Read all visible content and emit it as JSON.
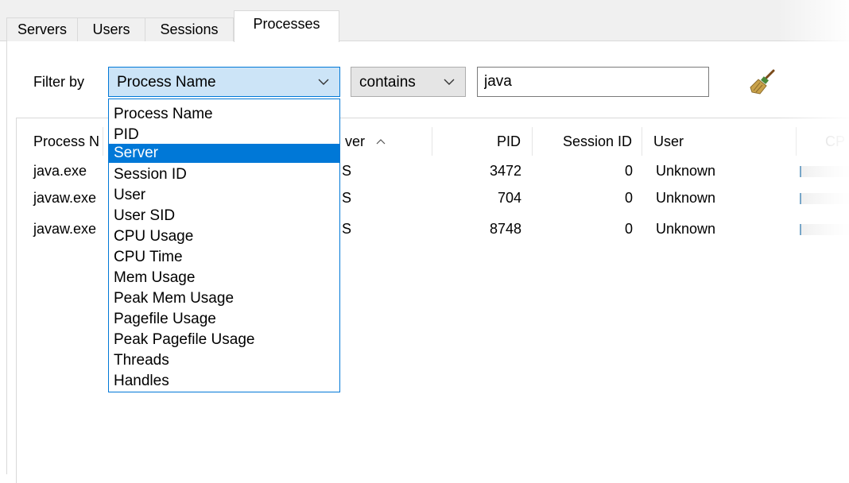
{
  "tabs": [
    {
      "label": "Servers"
    },
    {
      "label": "Users"
    },
    {
      "label": "Sessions"
    },
    {
      "label": "Processes",
      "active": true
    }
  ],
  "filter": {
    "label": "Filter by",
    "field_value": "Process Name",
    "operator_value": "contains",
    "text_value": "java"
  },
  "dropdown": {
    "options": [
      "Process Name",
      "PID",
      "Server",
      "Session ID",
      "User",
      "User SID",
      "CPU Usage",
      "CPU Time",
      "Mem Usage",
      "Peak Mem Usage",
      "Pagefile Usage",
      "Peak Pagefile Usage",
      "Threads",
      "Handles"
    ],
    "highlighted": "Server"
  },
  "columns": {
    "process_name": "Process N",
    "server": "ver",
    "pid": "PID",
    "session_id": "Session ID",
    "user": "User",
    "cpu": "CP"
  },
  "rows": [
    {
      "process_name": "java.exe",
      "server": "S",
      "pid": "3472",
      "session_id": "0",
      "user": "Unknown"
    },
    {
      "process_name": "javaw.exe",
      "server": "S",
      "pid": "704",
      "session_id": "0",
      "user": "Unknown"
    },
    {
      "process_name": "javaw.exe",
      "server": "S",
      "pid": "8748",
      "session_id": "0",
      "user": "Unknown"
    }
  ],
  "colors": {
    "accent": "#0078d7",
    "combo_focus_bg": "#cce4f7",
    "tabstrip_bg": "#f0f0f0"
  },
  "icons": {
    "combo_arrow": "chevron-down-icon",
    "sort_arrow": "chevron-up-icon",
    "clear_filter": "broom-icon"
  }
}
